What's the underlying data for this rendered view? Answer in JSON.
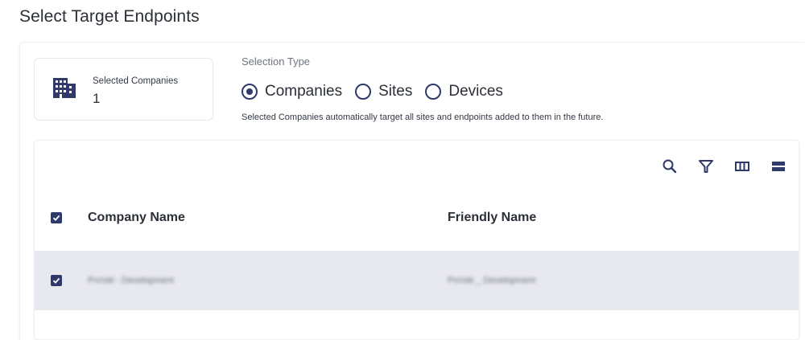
{
  "page": {
    "title": "Select Target Endpoints"
  },
  "summary": {
    "label": "Selected Companies",
    "value": "1",
    "icon": "building-icon"
  },
  "selection_type": {
    "label": "Selection Type",
    "options": [
      {
        "label": "Companies",
        "selected": true
      },
      {
        "label": "Sites",
        "selected": false
      },
      {
        "label": "Devices",
        "selected": false
      }
    ],
    "hint": "Selected Companies automatically target all sites and endpoints added to them in the future."
  },
  "toolbar": {
    "icons": [
      "search-icon",
      "filter-icon",
      "columns-icon",
      "density-icon"
    ]
  },
  "table": {
    "columns": [
      "Company Name",
      "Friendly Name"
    ],
    "header_checked": true,
    "rows": [
      {
        "checked": true,
        "company_name": "ProVal - Development",
        "friendly_name": "ProVal _ Development"
      }
    ]
  },
  "colors": {
    "accent": "#2f3a6b",
    "row_selected_bg": "#e8e9ef"
  }
}
